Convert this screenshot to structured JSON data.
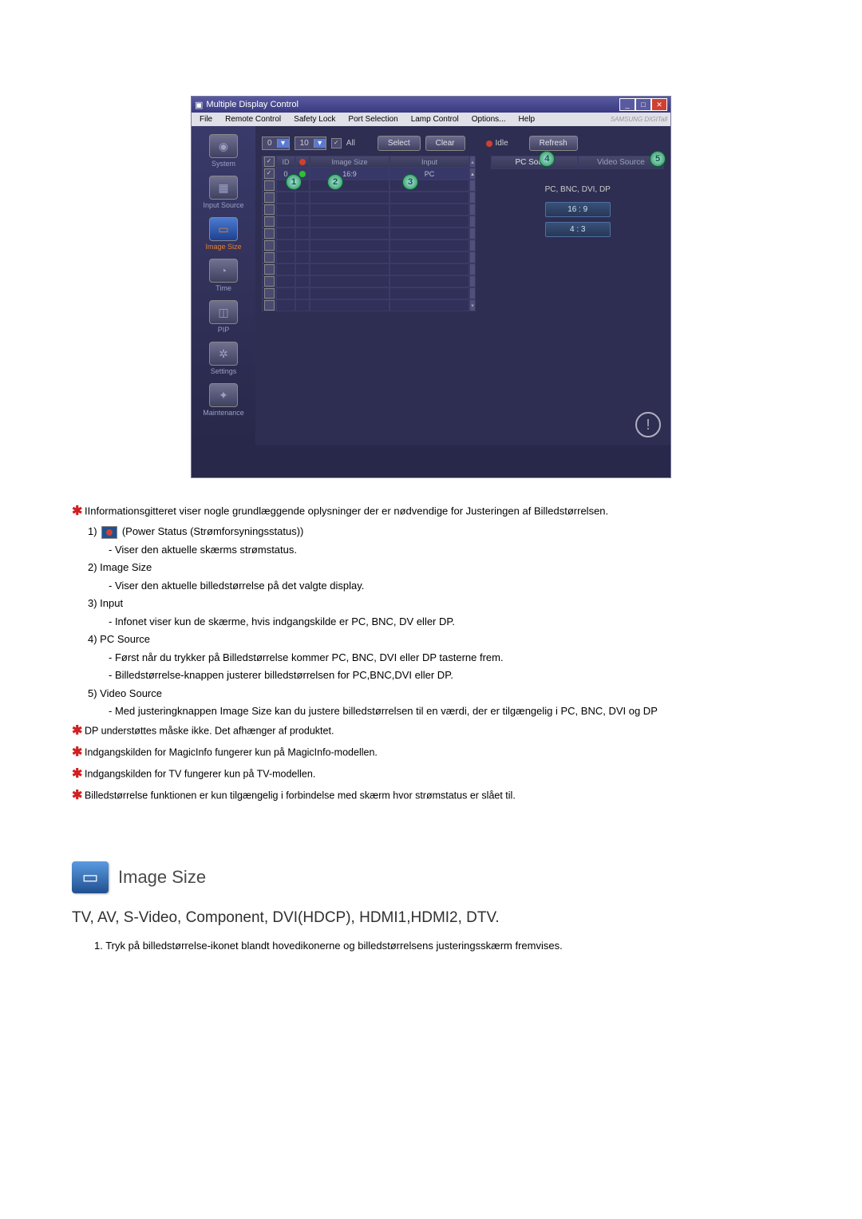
{
  "app": {
    "title": "Multiple Display Control",
    "menu": [
      "File",
      "Remote Control",
      "Safety Lock",
      "Port Selection",
      "Lamp Control",
      "Options...",
      "Help"
    ],
    "brand": "SAMSUNG DIGITall"
  },
  "sidebar": {
    "items": [
      {
        "label": "System"
      },
      {
        "label": "Input Source"
      },
      {
        "label": "Image Size",
        "selected": true
      },
      {
        "label": "Time"
      },
      {
        "label": "PIP"
      },
      {
        "label": "Settings"
      },
      {
        "label": "Maintenance"
      }
    ]
  },
  "top": {
    "dd1": "0",
    "dd2": "10",
    "all": "All",
    "select": "Select",
    "clear": "Clear",
    "idle": "Idle",
    "refresh": "Refresh"
  },
  "grid": {
    "head": {
      "id": "ID",
      "imagesize": "Image Size",
      "input": "Input"
    },
    "row1": {
      "id": "0",
      "imagesize": "16:9",
      "input": "PC"
    }
  },
  "right": {
    "pc": "PC Source",
    "video": "Video Source",
    "section": "PC, BNC, DVI, DP",
    "opt1": "16 : 9",
    "opt2": "4 : 3"
  },
  "callouts": {
    "c1": "1",
    "c2": "2",
    "c3": "3",
    "c4": "4",
    "c5": "5"
  },
  "doc": {
    "intro": "IInformationsgitteret viser nogle grundlæggende oplysninger der er nødvendige for Justeringen af Billedstørrelsen.",
    "n1": "1)",
    "n1t": "(Power Status (Strømforsyningsstatus))",
    "n1a": "- Viser den aktuelle skærms strømstatus.",
    "n2": "2)  Image Size",
    "n2a": "- Viser den aktuelle billedstørrelse på det valgte display.",
    "n3": "3)  Input",
    "n3a": "- Infonet viser kun de skærme, hvis indgangskilde er PC, BNC, DV eller DP.",
    "n4": "4)  PC Source",
    "n4a": "- Først når du trykker på Billedstørrelse kommer PC, BNC, DVI eller DP tasterne frem.",
    "n4b": "- Billedstørrelse-knappen justerer billedstørrelsen for PC,BNC,DVI eller DP.",
    "n5": "5)  Video Source",
    "n5a": "- Med justeringknappen Image Size kan du justere billedstørrelsen til en værdi, der er tilgængelig i PC, BNC, DVI og DP",
    "note1": "DP understøttes måske ikke. Det afhænger af produktet.",
    "note2": "Indgangskilden for MagicInfo fungerer kun på MagicInfo-modellen.",
    "note3": "Indgangskilden for TV fungerer kun på TV-modellen.",
    "note4": "Billedstørrelse funktionen er kun tilgængelig i forbindelse med skærm hvor strømstatus er slået til.",
    "section": "Image Size",
    "sub": "TV, AV, S-Video, Component, DVI(HDCP), HDMI1,HDMI2, DTV.",
    "step1": "1.  Tryk på billedstørrelse-ikonet blandt hovedikonerne og billedstørrelsens justeringsskærm fremvises."
  }
}
